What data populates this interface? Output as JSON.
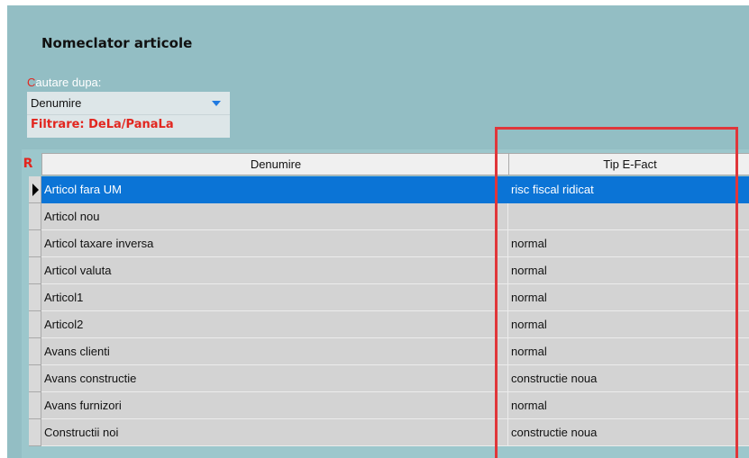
{
  "title": "Nomeclator articole",
  "search": {
    "label_first": "C",
    "label_rest": "autare dupa:",
    "selected": "Denumire"
  },
  "filter_text": "Filtrare: DeLa/PanaLa",
  "grid": {
    "corner_label": "R",
    "headers": {
      "name": "Denumire",
      "tip": "Tip E-Fact"
    },
    "rows": [
      {
        "name": "Articol fara UM",
        "tip": "risc fiscal ridicat"
      },
      {
        "name": "Articol nou",
        "tip": ""
      },
      {
        "name": "Articol taxare inversa",
        "tip": "normal"
      },
      {
        "name": "Articol valuta",
        "tip": "normal"
      },
      {
        "name": "Articol1",
        "tip": "normal"
      },
      {
        "name": "Articol2",
        "tip": "normal"
      },
      {
        "name": "Avans clienti",
        "tip": "normal"
      },
      {
        "name": "Avans constructie",
        "tip": "constructie noua"
      },
      {
        "name": "Avans furnizori",
        "tip": "normal"
      },
      {
        "name": "Constructii noi",
        "tip": "constructie noua"
      }
    ],
    "selected_row": 0
  },
  "colors": {
    "panel_bg": "#93bec4",
    "selection": "#0b74d6",
    "highlight_border": "#e0363a",
    "accent_red": "#e2261f"
  },
  "icons": {
    "dropdown": "chevron-down-icon",
    "row_pointer": "row-pointer-icon"
  }
}
